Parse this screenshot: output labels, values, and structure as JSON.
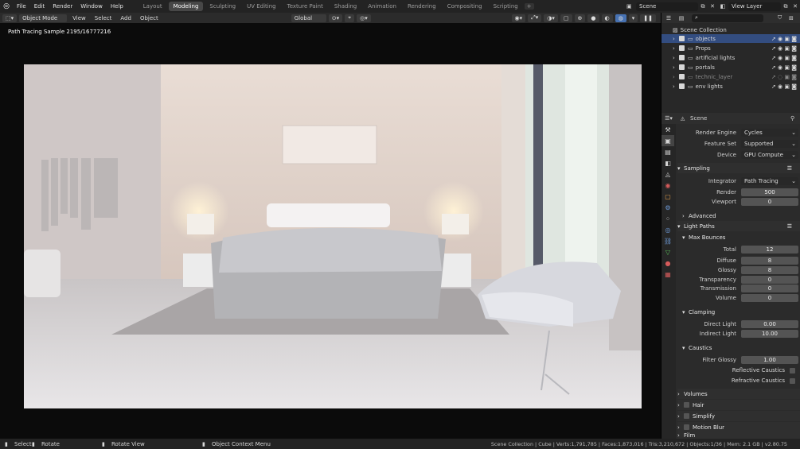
{
  "app": {
    "menus": [
      "File",
      "Edit",
      "Render",
      "Window",
      "Help"
    ],
    "workspaces": [
      "Layout",
      "Modeling",
      "Sculpting",
      "UV Editing",
      "Texture Paint",
      "Shading",
      "Animation",
      "Rendering",
      "Compositing",
      "Scripting"
    ],
    "active_workspace": "Modeling",
    "add_tab": "+",
    "scene": "Scene",
    "view_layer": "View Layer"
  },
  "header": {
    "mode": "Object Mode",
    "menus": [
      "View",
      "Select",
      "Add",
      "Object"
    ],
    "orientation": "Global"
  },
  "viewport": {
    "sample_text": "Path Tracing Sample 2195/16777216"
  },
  "outliner": {
    "search_placeholder": "",
    "root": "Scene Collection",
    "items": [
      {
        "name": "objects",
        "checked": true,
        "selected": true
      },
      {
        "name": "Props",
        "checked": true
      },
      {
        "name": "artificial lights",
        "checked": true
      },
      {
        "name": "portals",
        "checked": true
      },
      {
        "name": "technic_layer",
        "checked": true,
        "dim": true
      },
      {
        "name": "env lights",
        "checked": true
      }
    ]
  },
  "props": {
    "scene_name": "Scene",
    "render_engine": {
      "label": "Render Engine",
      "value": "Cycles"
    },
    "feature_set": {
      "label": "Feature Set",
      "value": "Supported"
    },
    "device": {
      "label": "Device",
      "value": "GPU Compute"
    },
    "sampling": "Sampling",
    "integrator": {
      "label": "Integrator",
      "value": "Path Tracing"
    },
    "render": {
      "label": "Render",
      "value": "500"
    },
    "viewport": {
      "label": "Viewport",
      "value": "0"
    },
    "advanced": "Advanced",
    "light_paths": "Light Paths",
    "max_bounces": "Max Bounces",
    "total": {
      "label": "Total",
      "value": "12"
    },
    "diffuse": {
      "label": "Diffuse",
      "value": "8"
    },
    "glossy": {
      "label": "Glossy",
      "value": "8"
    },
    "transparency": {
      "label": "Transparency",
      "value": "0"
    },
    "transmission": {
      "label": "Transmission",
      "value": "0"
    },
    "volume": {
      "label": "Volume",
      "value": "0"
    },
    "clamping": "Clamping",
    "direct": {
      "label": "Direct Light",
      "value": "0.00"
    },
    "indirect": {
      "label": "Indirect Light",
      "value": "10.00"
    },
    "caustics": "Caustics",
    "filter_glossy": {
      "label": "Filter Glossy",
      "value": "1.00"
    },
    "reflective": "Reflective Caustics",
    "refractive": "Refractive Caustics",
    "volumes": "Volumes",
    "hair": "Hair",
    "simplify": "Simplify",
    "motion_blur": "Motion Blur",
    "film": "Film"
  },
  "status": {
    "select": "Select",
    "rotate": "Rotate",
    "rotate_view": "Rotate View",
    "context": "Object Context Menu",
    "stats": "Scene Collection | Cube | Verts:1,791,785 | Faces:1,873,016 | Tris:3,210,672 | Objects:1/36 | Mem: 2.1 GB | v2.80.75"
  },
  "colors": {
    "accent": "#4772b3",
    "selected_row": "#334d80"
  }
}
